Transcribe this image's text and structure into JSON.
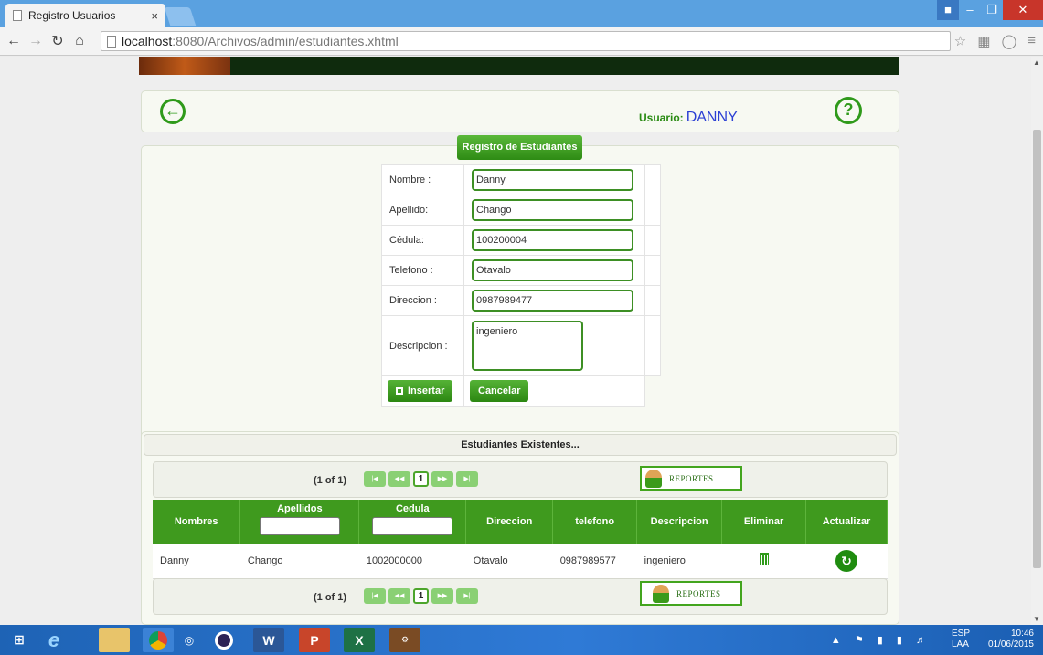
{
  "browser": {
    "tab_title": "Registro Usuarios",
    "tab_close": "×",
    "url_host": "localhost",
    "url_path": ":8080/Archivos/admin/estudiantes.xhtml"
  },
  "header": {
    "usuario_label": "Usuario:",
    "usuario_name": "DANNY"
  },
  "form": {
    "title": "Registro de Estudiantes",
    "fields": [
      {
        "label": "Nombre :",
        "value": "Danny"
      },
      {
        "label": "Apellido:",
        "value": "Chango"
      },
      {
        "label": "Cédula:",
        "value": "100200004"
      },
      {
        "label": "Telefono :",
        "value": "Otavalo"
      },
      {
        "label": "Direccion :",
        "value": "0987989477"
      },
      {
        "label": "Descripcion :",
        "value": "ingeniero"
      }
    ],
    "insert_label": "Insertar",
    "cancel_label": "Cancelar"
  },
  "list": {
    "title": "Estudiantes Existentes...",
    "page_info": "(1 of 1)",
    "current_page": "1",
    "report_label": "REPORTES",
    "columns": [
      "Nombres",
      "Apellidos",
      "Cedula",
      "Direccion",
      "telefono",
      "Descripcion",
      "Eliminar",
      "Actualizar"
    ],
    "rows": [
      {
        "nombres": "Danny",
        "apellidos": "Chango",
        "cedula": "1002000000",
        "direccion": "Otavalo",
        "telefono": "0987989577",
        "descripcion": "ingeniero"
      }
    ]
  },
  "taskbar": {
    "lang_top": "ESP",
    "lang_bottom": "LAA",
    "time": "10:46",
    "date": "01/06/2015"
  },
  "colors": {
    "accent_green": "#3f9a1e",
    "titlebar_blue": "#5aa1e0",
    "user_blue": "#2b3fd4"
  }
}
